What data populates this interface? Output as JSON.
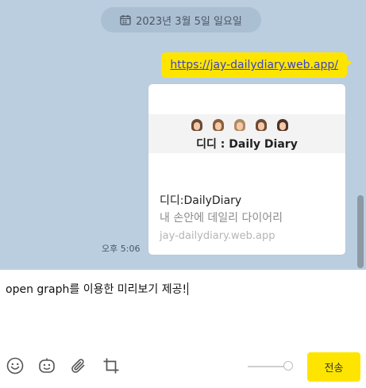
{
  "chat": {
    "date_label": "2023년 3월 5일 일요일",
    "sent_message": "https://jay-dailydiary.web.app/",
    "og_card": {
      "brand": "디디 : Daily Diary",
      "title": "디디:DailyDiary",
      "description": "내 손안에 데일리 다이어리",
      "url": "jay-dailydiary.web.app"
    },
    "time": "오후 5:06"
  },
  "composer": {
    "input_value": "open graph를 이용한 미리보기 제공!",
    "send_label": "전송",
    "tools": [
      "emoji-icon",
      "emoticon-box-icon",
      "attach-icon",
      "crop-icon"
    ]
  },
  "colors": {
    "chat_bg": "#bacee0",
    "bubble": "#fee500",
    "link": "#3a43c8"
  }
}
